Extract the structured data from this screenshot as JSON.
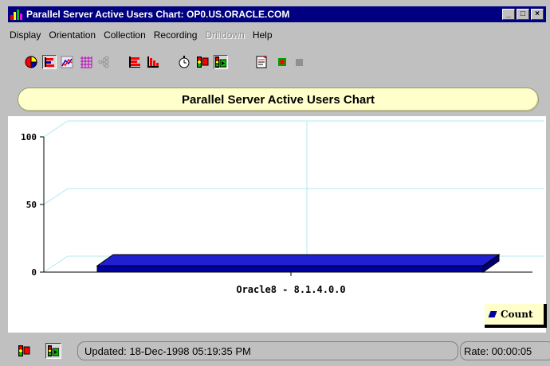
{
  "window": {
    "title": "Parallel Server Active Users Chart: OP0.US.ORACLE.COM"
  },
  "menu": {
    "display": "Display",
    "orientation": "Orientation",
    "collection": "Collection",
    "recording": "Recording",
    "drilldown": "Drilldown",
    "help": "Help"
  },
  "toolbar": {
    "icons": [
      "pie-chart-icon",
      "horizontal-bar-chart-icon",
      "line-chart-icon",
      "grid-table-icon",
      "hierarchy-icon",
      "horizontal-bars-icon",
      "vertical-bars-icon",
      "stopwatch-icon",
      "traffic-light-icon",
      "traffic-light-play-icon",
      "report-icon",
      "record-icon",
      "stop-icon"
    ]
  },
  "chart": {
    "title": "Parallel Server Active Users Chart"
  },
  "chart_data": {
    "type": "bar",
    "orientation": "horizontal",
    "categories": [
      "Oracle8 - 8.1.4.0.0"
    ],
    "series": [
      {
        "name": "Count",
        "values": [
          0
        ]
      }
    ],
    "xlabel": "",
    "ylabel": "",
    "ylim": [
      0,
      100
    ],
    "yticks": [
      "0",
      "50",
      "100"
    ],
    "grid": true,
    "legend": "bottom-right",
    "bar_color": "#0000a0"
  },
  "legend": {
    "label": "Count"
  },
  "status": {
    "updated": "Updated: 18-Dec-1998 05:19:35 PM",
    "rate": "Rate: 00:00:05"
  },
  "colors": {
    "titlebar": "#000080",
    "title_pill": "#ffffcc",
    "bar": "#0000a0"
  }
}
